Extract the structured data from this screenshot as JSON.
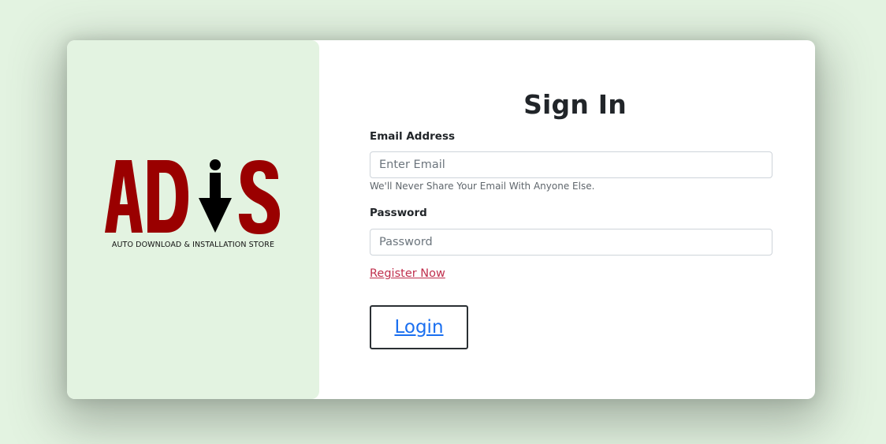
{
  "logo": {
    "wordmark": "ADiS",
    "tagline": "AUTO DOWNLOAD & INSTALLATION STORE",
    "brand_color": "#9a0000"
  },
  "form": {
    "title": "Sign In",
    "email_label": "Email Address",
    "email_placeholder": "Enter Email",
    "email_help": "We'll Never Share Your Email With Anyone Else.",
    "password_label": "Password",
    "password_placeholder": "Password",
    "register_link": "Register Now",
    "login_button": "Login"
  },
  "colors": {
    "background": "#e3f3e1",
    "link": "#c0304e",
    "button_text": "#1a6ff0"
  }
}
